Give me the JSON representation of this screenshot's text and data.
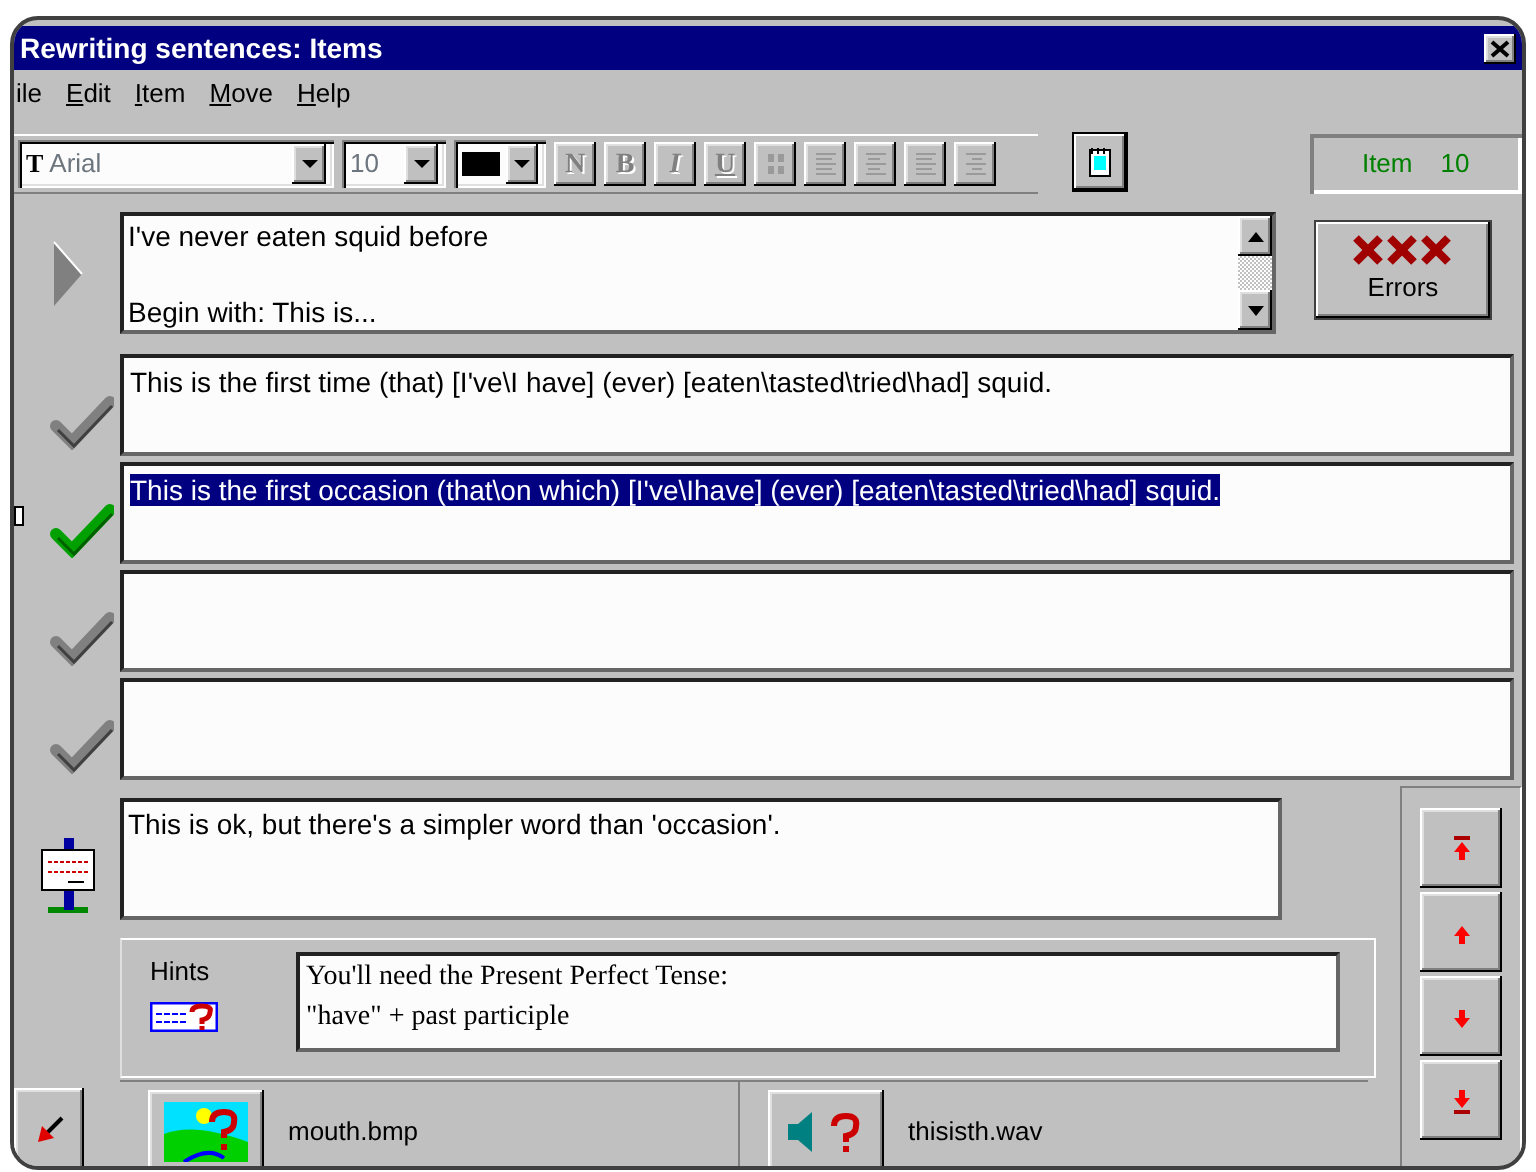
{
  "window": {
    "title": "Rewriting sentences: Items"
  },
  "menu": [
    {
      "rest": "ile"
    },
    {
      "accel": "E",
      "rest": "dit"
    },
    {
      "accel": "I",
      "rest": "tem"
    },
    {
      "accel": "M",
      "rest": "ove"
    },
    {
      "accel": "H",
      "rest": "elp"
    }
  ],
  "toolbar": {
    "font_glyph": "T",
    "font": {
      "value": "Arial",
      "disabled": true
    },
    "size": {
      "value": "10",
      "disabled": true
    },
    "color": "#000000",
    "format_buttons": [
      {
        "label": "N",
        "disabled": true
      },
      {
        "label": "B",
        "disabled": true
      },
      {
        "label": "I",
        "disabled": true
      },
      {
        "label": "U",
        "disabled": true
      }
    ]
  },
  "item_counter": {
    "label": "Item",
    "value": "10"
  },
  "prompt": {
    "sentence": "I've never eaten squid before",
    "instruction": "Begin with: This is..."
  },
  "errors_button": {
    "label": "Errors"
  },
  "answers": [
    {
      "text": "This is the first time (that) [I've\\I have] (ever) [eaten\\tasted\\tried\\had] squid.",
      "selected": false
    },
    {
      "text": "This is the first occasion (that\\on which) [I've\\Ihave] (ever) [eaten\\tasted\\tried\\had] squid.",
      "selected": true
    },
    {
      "selected": false
    },
    {
      "selected": false
    }
  ],
  "feedback": {
    "text": "This is ok, but there's a simpler word than 'occasion'."
  },
  "hints": {
    "label": "Hints",
    "lines": [
      "You'll need the Present Perfect Tense:",
      "\"have\" + past participle"
    ]
  },
  "media": [
    {
      "kind": "picture",
      "file": "mouth.bmp"
    },
    {
      "kind": "sound",
      "file": "thisisth.wav"
    }
  ]
}
